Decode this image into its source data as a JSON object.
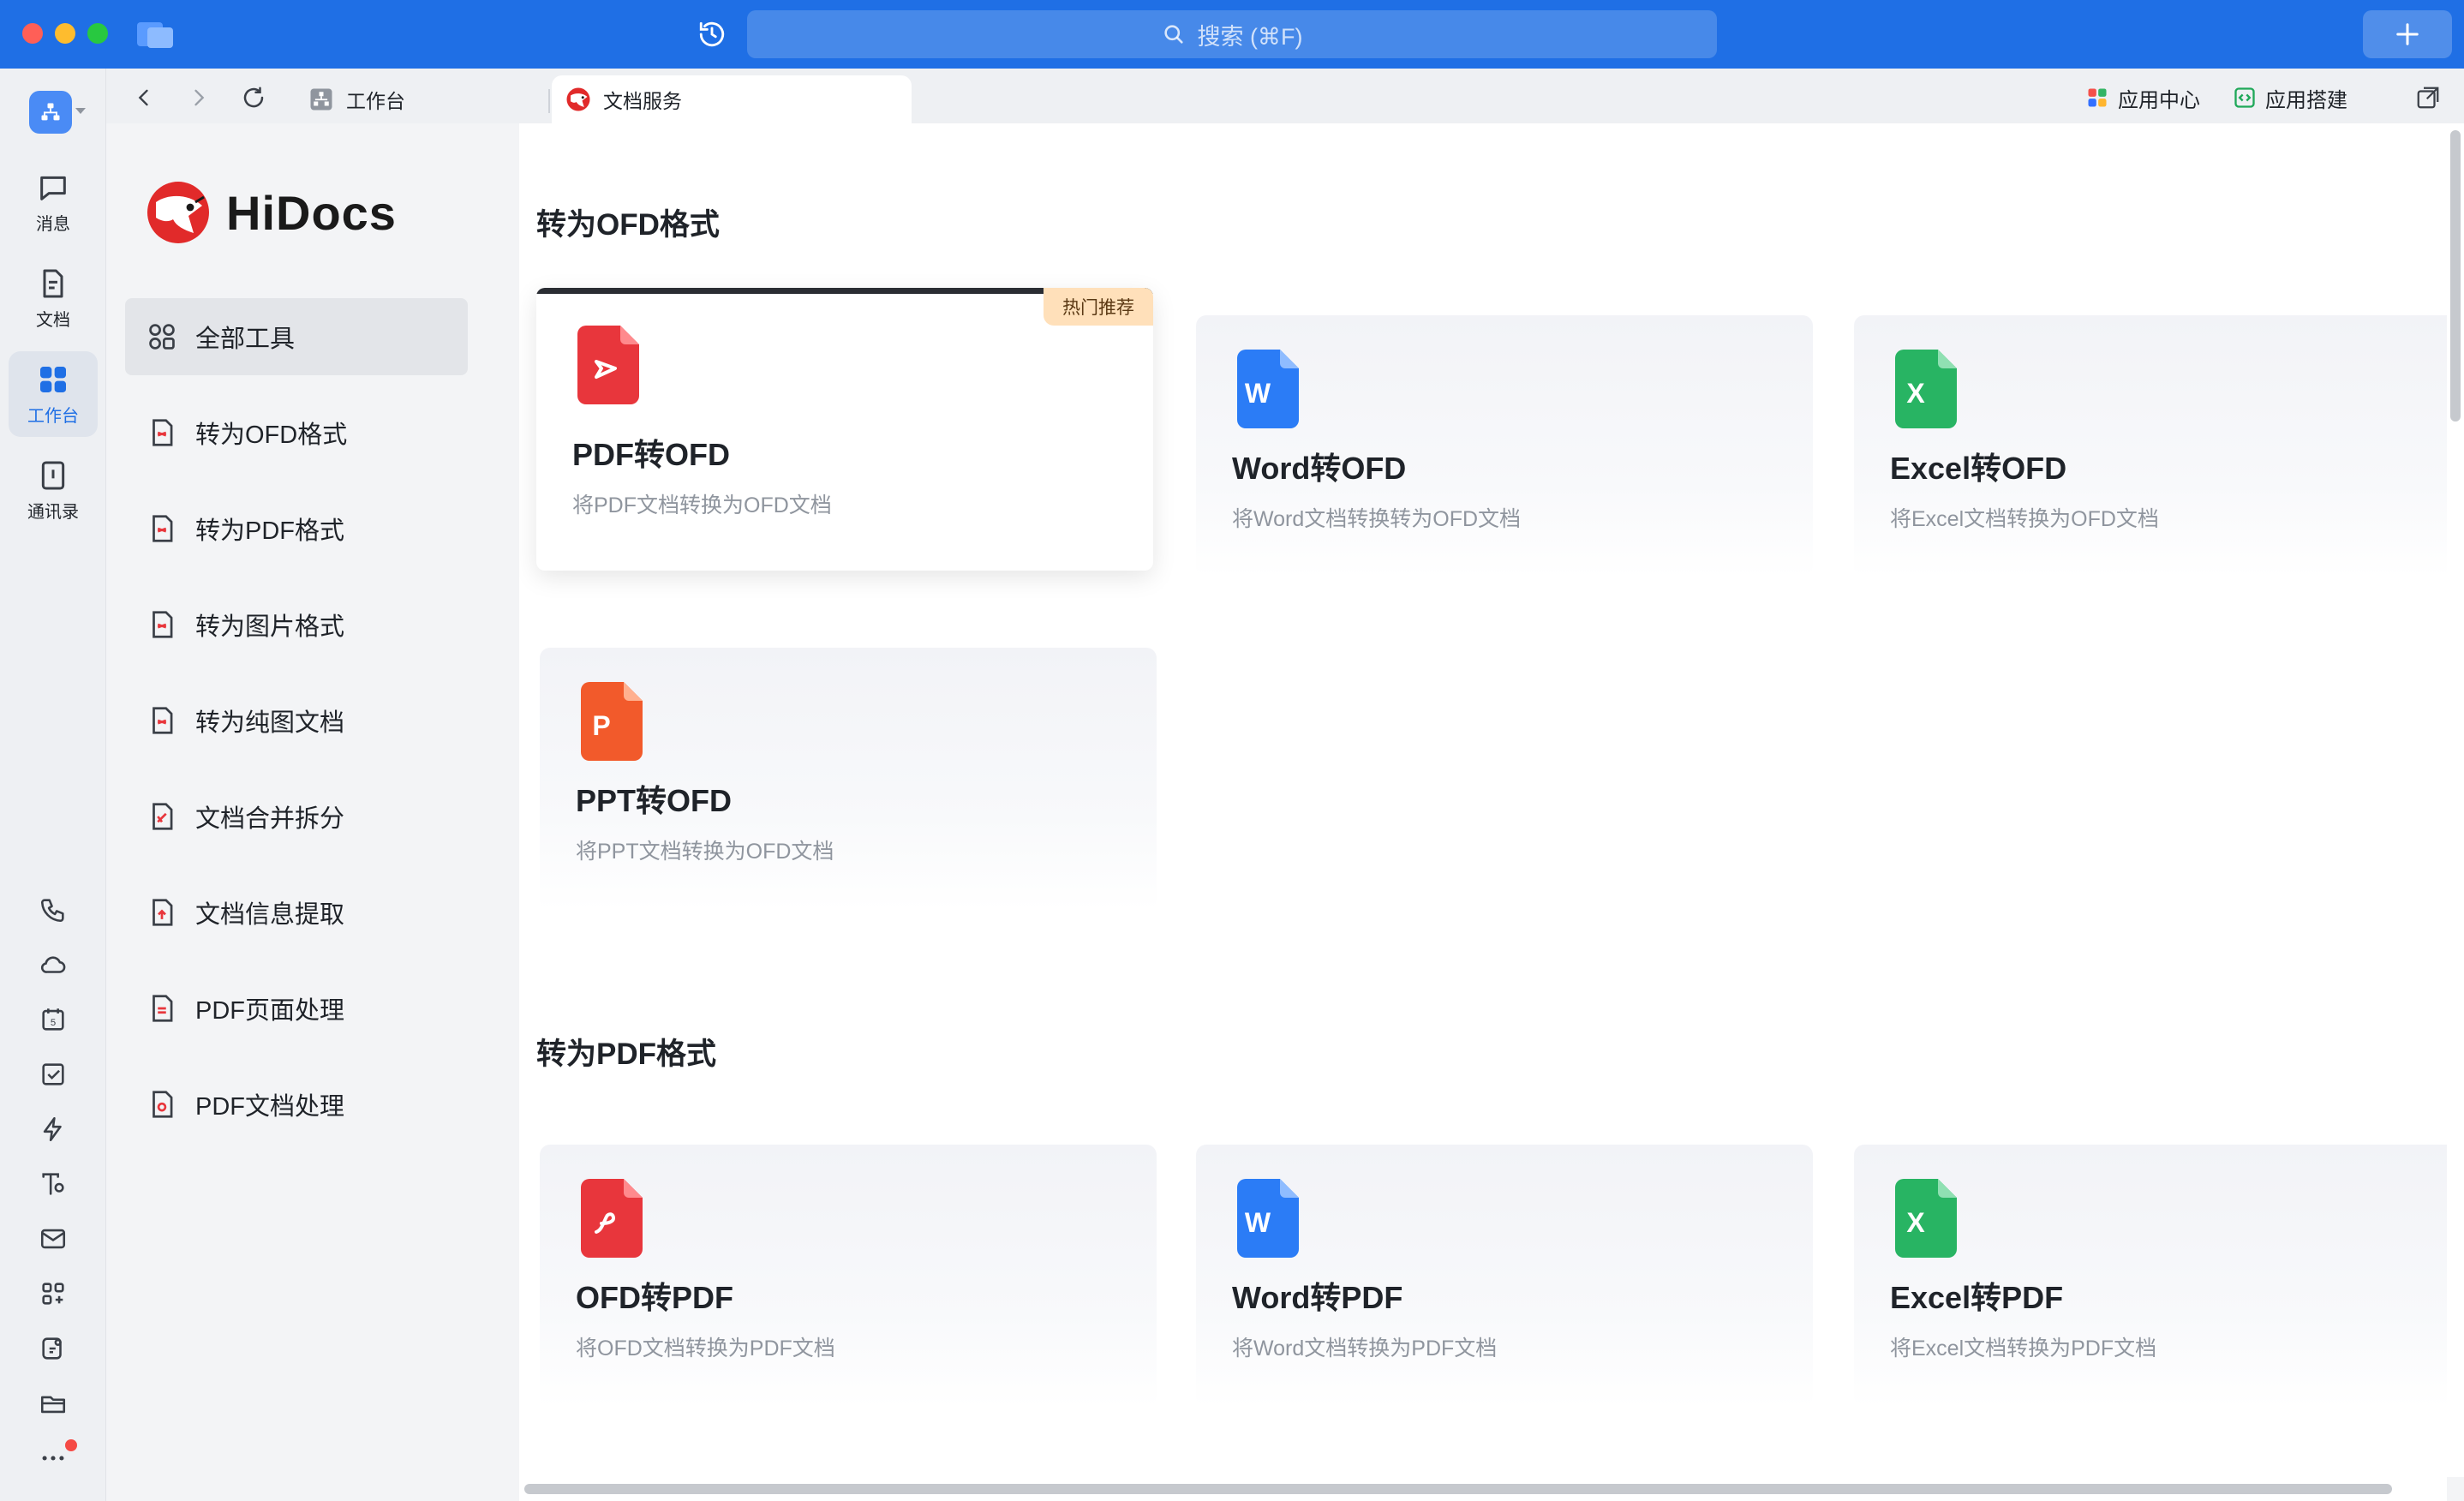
{
  "titlebar": {
    "search_placeholder": "搜索 (⌘F)",
    "accent_color": "#1f6fe5"
  },
  "rail": {
    "items": [
      {
        "label": "消息",
        "icon": "message-icon"
      },
      {
        "label": "文档",
        "icon": "document-icon"
      },
      {
        "label": "工作台",
        "icon": "workbench-grid-icon"
      },
      {
        "label": "通讯录",
        "icon": "contacts-icon"
      }
    ],
    "bottom_icons": [
      "phone-icon",
      "cloud-icon",
      "calendar-icon",
      "task-check-icon",
      "lightning-icon",
      "text-tool-icon",
      "mail-icon",
      "apps-add-icon",
      "doc-edit-icon",
      "folder-icon",
      "more-icon"
    ],
    "calendar_day": "5"
  },
  "tabs": {
    "items": [
      {
        "label": "工作台"
      },
      {
        "label": "文档服务"
      }
    ],
    "right_links": [
      {
        "label": "应用中心"
      },
      {
        "label": "应用搭建"
      }
    ]
  },
  "sidebar": {
    "logo_text": "HiDocs",
    "menu": [
      {
        "label": "全部工具"
      },
      {
        "label": "转为OFD格式"
      },
      {
        "label": "转为PDF格式"
      },
      {
        "label": "转为图片格式"
      },
      {
        "label": "转为纯图文档"
      },
      {
        "label": "文档合并拆分"
      },
      {
        "label": "文档信息提取"
      },
      {
        "label": "PDF页面处理"
      },
      {
        "label": "PDF文档处理"
      }
    ]
  },
  "sections": [
    {
      "title": "转为OFD格式",
      "cards": [
        {
          "title": "PDF转OFD",
          "desc": "将PDF文档转换为OFD文档",
          "badge": "热门推荐",
          "icon_letter": ""
        },
        {
          "title": "Word转OFD",
          "desc": "将Word文档转换转为OFD文档",
          "icon_letter": "W"
        },
        {
          "title": "Excel转OFD",
          "desc": "将Excel文档转换为OFD文档",
          "icon_letter": "X"
        },
        {
          "title": "PPT转OFD",
          "desc": "将PPT文档转换为OFD文档",
          "icon_letter": "P"
        }
      ]
    },
    {
      "title": "转为PDF格式",
      "cards": [
        {
          "title": "OFD转PDF",
          "desc": "将OFD文档转换为PDF文档",
          "icon_letter": ""
        },
        {
          "title": "Word转PDF",
          "desc": "将Word文档转换为PDF文档",
          "icon_letter": "W"
        },
        {
          "title": "Excel转PDF",
          "desc": "将Excel文档转换为PDF文档",
          "icon_letter": "X"
        }
      ]
    }
  ],
  "colors": {
    "pdf_red": "#e8363c",
    "word_blue": "#2b7cf6",
    "excel_green": "#28b463",
    "ppt_orange": "#f25a2b",
    "hot_badge_bg": "#ffe0ba"
  }
}
